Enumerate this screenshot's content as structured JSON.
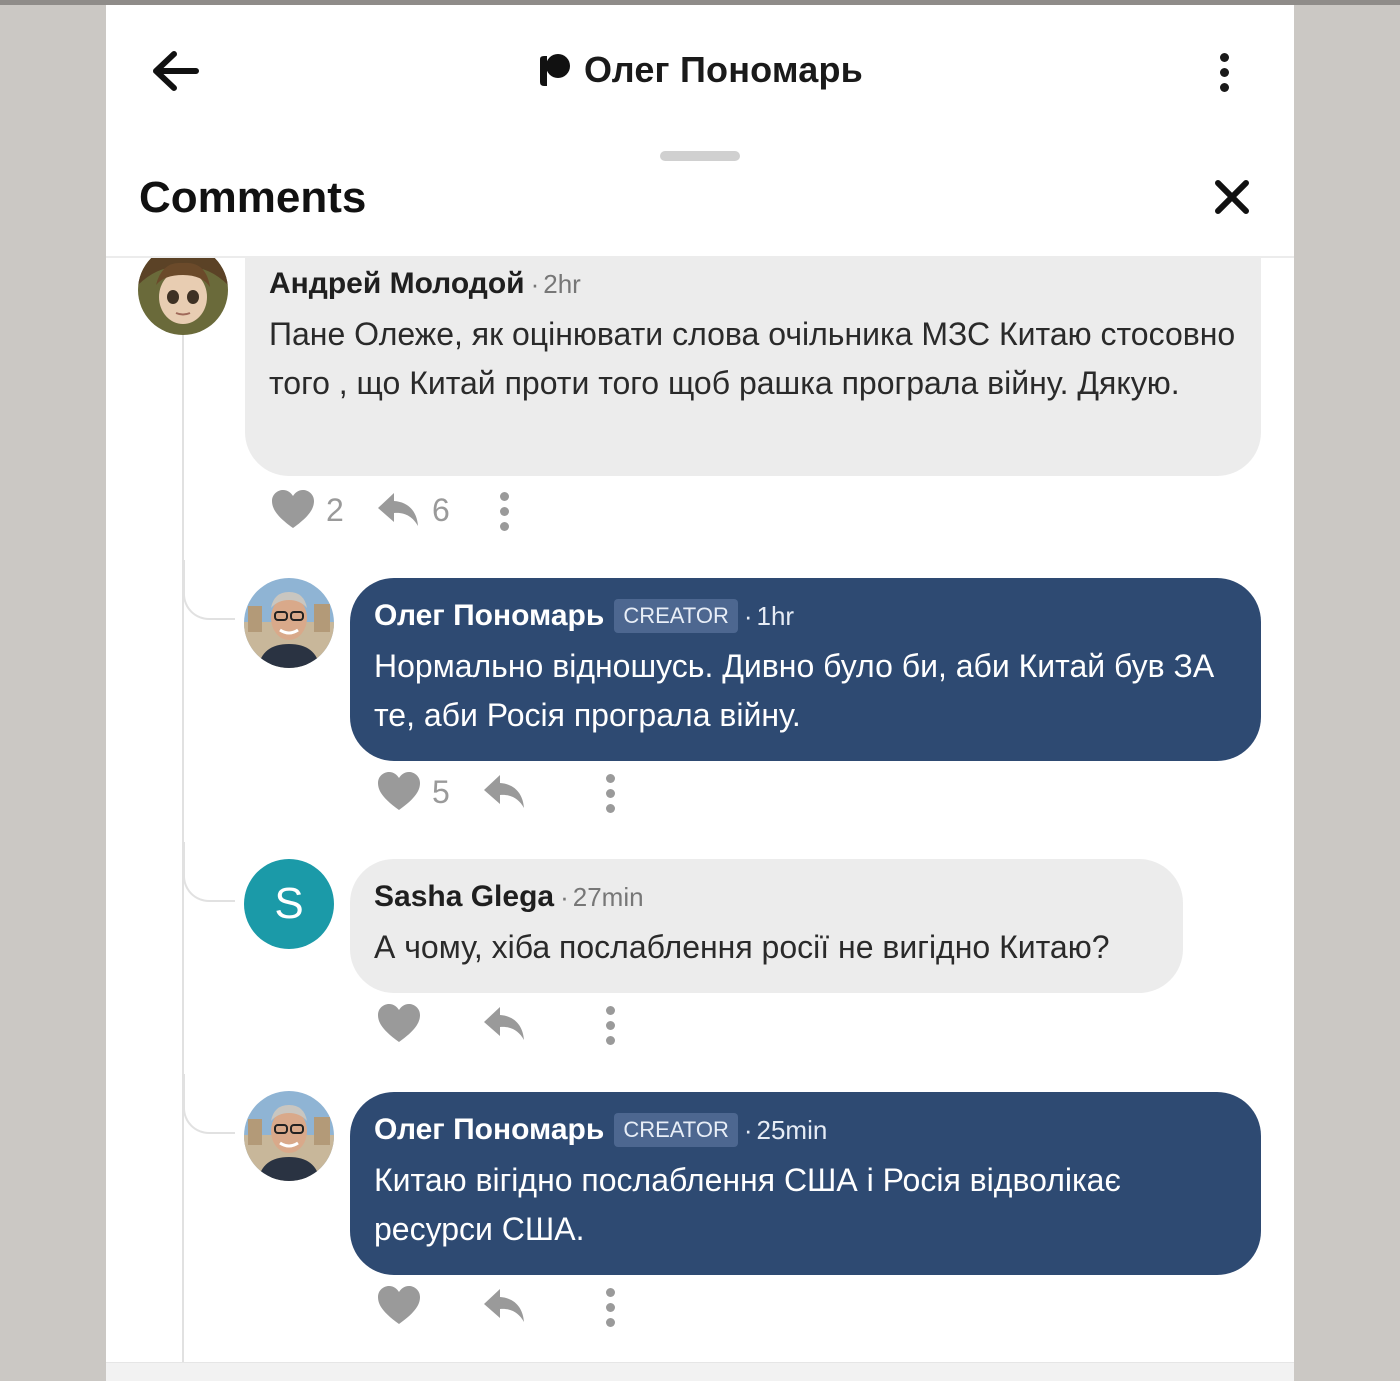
{
  "header": {
    "title": "Олег Пономарь"
  },
  "sheet": {
    "title": "Comments"
  },
  "comments": [
    {
      "author": "Андрей Молодой",
      "time": "2hr",
      "text": "Пане Олеже, як оцінювати слова очільника МЗС Китаю стосовно того ,  що Китай проти того щоб рашка програла війну. Дякую.",
      "likes": "2",
      "replies": "6"
    },
    {
      "author": "Олег Пономарь",
      "badge": "CREATOR",
      "time": "1hr",
      "text": "Нормально відношусь. Дивно було би, аби Китай був ЗА те, аби Росія програла війну.",
      "likes": "5"
    },
    {
      "author": "Sasha Glega",
      "avatar_letter": "S",
      "time": "27min",
      "text": "А чому, хіба послаблення росії не вигідно Китаю?"
    },
    {
      "author": "Олег Пономарь",
      "badge": "CREATOR",
      "time": "25min",
      "text": "Китаю вігідно послаблення США і Росія відволікає ресурси США."
    }
  ],
  "colors": {
    "creator_bubble": "#2e4a72",
    "user_bubble": "#ececec",
    "avatar_s": "#1b9aa8",
    "icon_gray": "#9a9a9a"
  },
  "icons": [
    "back-arrow-icon",
    "patreon-logo",
    "more-vertical-icon",
    "close-icon",
    "heart-icon",
    "reply-icon"
  ]
}
